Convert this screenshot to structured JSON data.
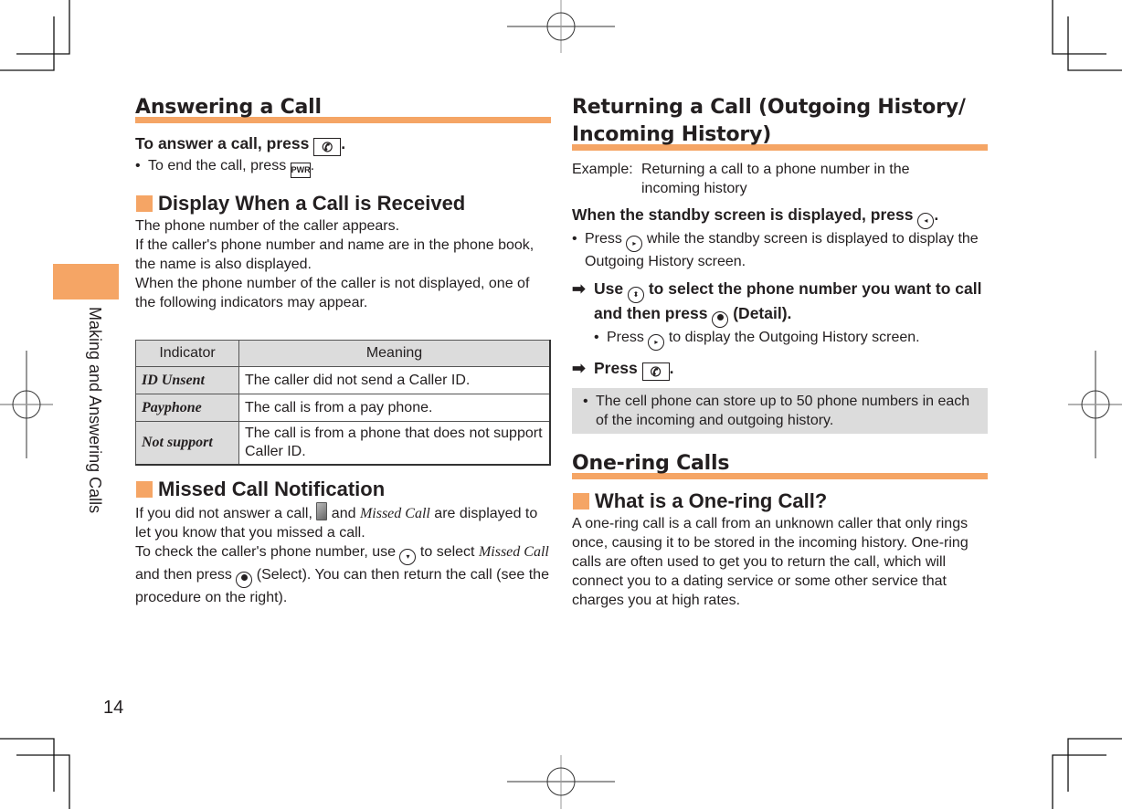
{
  "side_tab": {
    "label": "Making and Answering Calls",
    "color": "#f5a565"
  },
  "page_number": "14",
  "left": {
    "answering": {
      "title": "Answering a Call",
      "instruction_prefix": "To answer a call, press",
      "instruction_key": "send-key",
      "instruction_suffix": ".",
      "bullet_prefix": "To end the call, press",
      "bullet_key": "PWR",
      "bullet_suffix": "."
    },
    "display": {
      "title": "Display When a Call is Received",
      "paragraphs": [
        "The phone number of the caller appears.",
        "If the caller's phone number and name are in the phone book, the name is also displayed.",
        "When the phone number of the caller is not displayed, one of the following indicators may appear."
      ],
      "table": {
        "headers": [
          "Indicator",
          "Meaning"
        ],
        "rows": [
          {
            "indicator": "ID Unsent",
            "meaning": "The caller did not send a Caller ID."
          },
          {
            "indicator": "Payphone",
            "meaning": "The call is from a pay phone."
          },
          {
            "indicator": "Not support",
            "meaning": "The call is from a phone that does not support Caller ID."
          }
        ]
      }
    },
    "missed": {
      "title": "Missed Call Notification",
      "p1_a": "If you did not answer a call,",
      "p1_b": "and",
      "p1_term": "Missed Call",
      "p1_c": "are displayed to let you know that you missed a call.",
      "p2_a": "To check the caller's phone number, use",
      "p2_b": "to select",
      "p2_term": "Missed Call",
      "p2_c": "and then press",
      "p2_d": "(Select). You can then return the call (see the procedure on the right)."
    }
  },
  "right": {
    "returning": {
      "title_line1": "Returning a Call (Outgoing History/",
      "title_line2": "Incoming History)",
      "example_label": "Example:",
      "example_text": "Returning a call to a phone number in the incoming history",
      "step0_prefix": "When the standby screen is displayed, press",
      "step0_suffix": ".",
      "bullet0_a": "Press",
      "bullet0_b": "while the standby screen is displayed to display the Outgoing History screen.",
      "step1_a": "Use",
      "step1_b": "to select the phone number you want to call and then press",
      "step1_c": "(Detail).",
      "bullet1_a": "Press",
      "bullet1_b": "to display the Outgoing History screen.",
      "step2_a": "Press",
      "step2_b": ".",
      "note": "The cell phone can store up to 50 phone numbers in each of the incoming and outgoing history."
    },
    "one_ring": {
      "title": "One-ring Calls",
      "subtitle": "What is a One-ring Call?",
      "body": "A one-ring call is a call from an unknown caller that only rings once, causing it to be stored in the incoming history. One-ring calls are often used to get you to return the call, which will connect you to a dating service or some other service that charges you at high rates."
    }
  },
  "icons": {
    "arrow": "➡",
    "bullet": "•"
  }
}
